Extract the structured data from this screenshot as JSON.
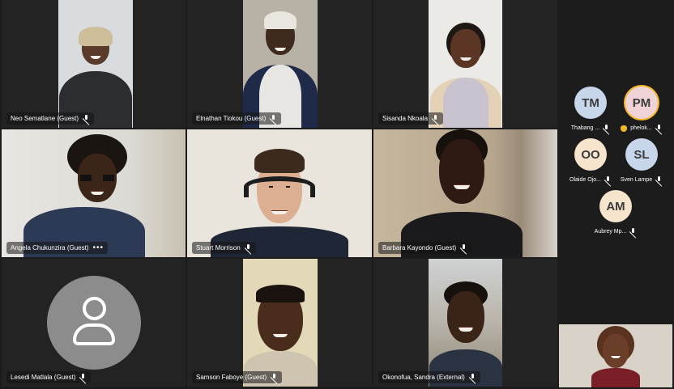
{
  "grid": {
    "tiles": [
      {
        "name": "Neo Sematlane (Guest)"
      },
      {
        "name": "Elnathan Tiokou (Guest)"
      },
      {
        "name": "Sisanda Nkoala"
      },
      {
        "name": "Angela Chukunzira (Guest)",
        "more_icon": "more-options-icon",
        "more_symbol": "•••"
      },
      {
        "name": "Stuart Morrison"
      },
      {
        "name": "Barbara Kayondo (Guest)"
      },
      {
        "name": "Lesedi Matlala (Guest)"
      },
      {
        "name": "Samson Faboye (Guest)"
      },
      {
        "name": "Okonofua, Sandra (External)"
      }
    ]
  },
  "side_panel": {
    "attendees": [
      {
        "initials": "TM",
        "name": "Thabang ...",
        "color": "#c7d6ea",
        "hand_raised": false
      },
      {
        "initials": "PM",
        "name": "phelok...",
        "color": "#f0d3d6",
        "hand_raised": true
      },
      {
        "initials": "OO",
        "name": "Olaide Ojo...",
        "color": "#f6e4cd",
        "hand_raised": false
      },
      {
        "initials": "SL",
        "name": "Sven Lampe",
        "color": "#c7d6ea",
        "hand_raised": false
      },
      {
        "initials": "AM",
        "name": "Aubrey Mp...",
        "color": "#f6e4cd",
        "hand_raised": false
      }
    ]
  },
  "colors": {
    "background": "#1c1c1c",
    "tile_background": "#232323",
    "avatar_gray": "#8c8c8c",
    "raised_hand": "#f2b72b",
    "active_speaker_ring": "#f2b72b"
  },
  "icons": {
    "muted": "mic-off-icon",
    "raised_hand": "raised-hand-icon",
    "placeholder_avatar": "person-icon"
  }
}
